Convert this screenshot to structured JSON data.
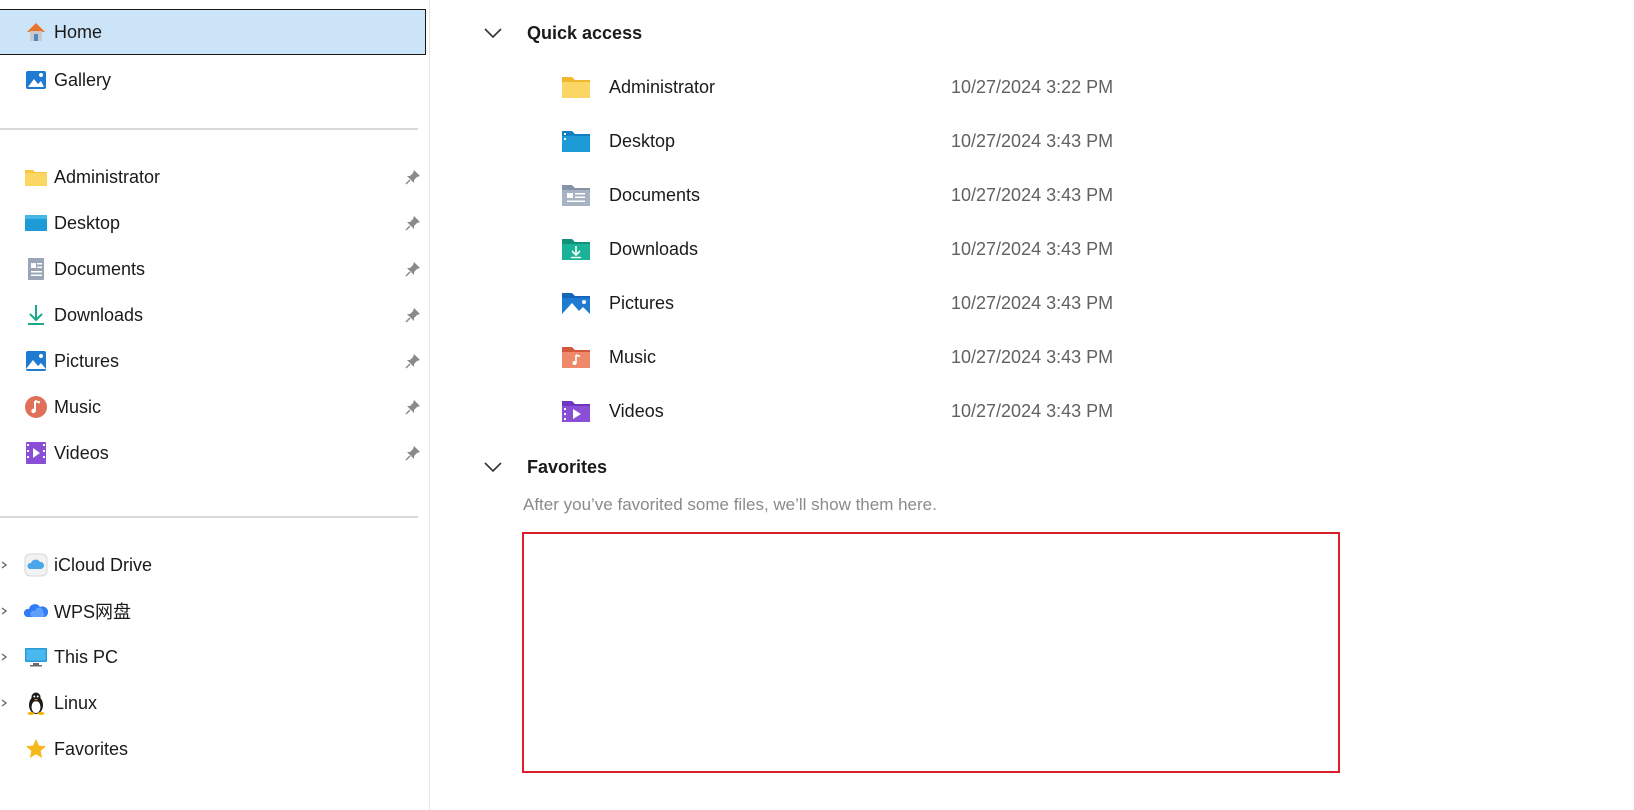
{
  "sidebar": {
    "top_items": [
      {
        "label": "Home",
        "icon": "home-icon",
        "selected": true
      },
      {
        "label": "Gallery",
        "icon": "gallery-icon",
        "selected": false
      }
    ],
    "pinned_items": [
      {
        "label": "Administrator",
        "icon": "folder-icon"
      },
      {
        "label": "Desktop",
        "icon": "desktop-icon"
      },
      {
        "label": "Documents",
        "icon": "documents-icon"
      },
      {
        "label": "Downloads",
        "icon": "downloads-icon"
      },
      {
        "label": "Pictures",
        "icon": "pictures-icon"
      },
      {
        "label": "Music",
        "icon": "music-icon"
      },
      {
        "label": "Videos",
        "icon": "videos-icon"
      }
    ],
    "drive_items": [
      {
        "label": "iCloud Drive",
        "icon": "icloud-icon"
      },
      {
        "label": "WPS网盘",
        "icon": "wps-cloud-icon"
      },
      {
        "label": "This PC",
        "icon": "pc-icon"
      },
      {
        "label": "Linux",
        "icon": "linux-icon"
      },
      {
        "label": "Favorites",
        "icon": "star-icon"
      }
    ]
  },
  "main": {
    "quick_access": {
      "title": "Quick access",
      "items": [
        {
          "name": "Administrator",
          "date": "10/27/2024 3:22 PM",
          "icon": "folder-icon"
        },
        {
          "name": "Desktop",
          "date": "10/27/2024 3:43 PM",
          "icon": "desktop-icon"
        },
        {
          "name": "Documents",
          "date": "10/27/2024 3:43 PM",
          "icon": "documents-icon"
        },
        {
          "name": "Downloads",
          "date": "10/27/2024 3:43 PM",
          "icon": "downloads-icon"
        },
        {
          "name": "Pictures",
          "date": "10/27/2024 3:43 PM",
          "icon": "pictures-icon"
        },
        {
          "name": "Music",
          "date": "10/27/2024 3:43 PM",
          "icon": "music-icon"
        },
        {
          "name": "Videos",
          "date": "10/27/2024 3:43 PM",
          "icon": "videos-icon"
        }
      ]
    },
    "favorites": {
      "title": "Favorites",
      "empty_message": "After you’ve favorited some files, we’ll show them here."
    }
  },
  "colors": {
    "selection": "#cce4f7",
    "highlight_border": "#d71f2b",
    "folder_yellow": "#f8c842"
  }
}
